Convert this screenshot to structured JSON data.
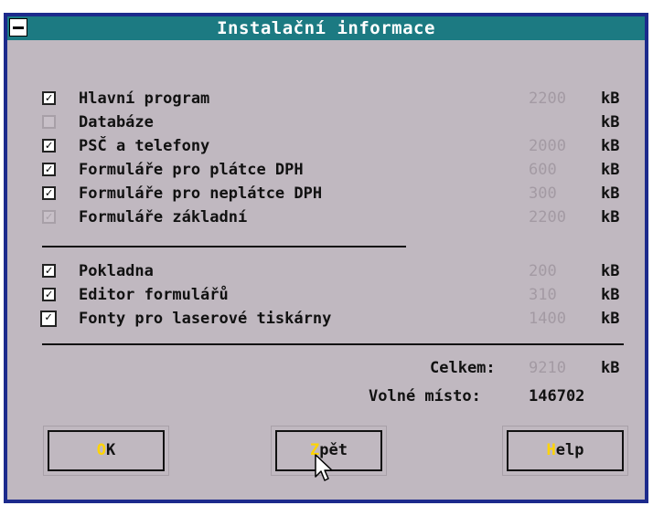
{
  "window": {
    "title": "Instalační informace"
  },
  "items_group1": [
    {
      "label": "Hlavní program",
      "size": "2200",
      "unit": "kB",
      "checked": true,
      "state": "normal"
    },
    {
      "label": "Databáze",
      "size": "",
      "unit": "kB",
      "checked": false,
      "state": "dim"
    },
    {
      "label": "PSČ a telefony",
      "size": "2000",
      "unit": "kB",
      "checked": true,
      "state": "normal"
    },
    {
      "label": "Formuláře pro plátce DPH",
      "size": "600",
      "unit": "kB",
      "checked": true,
      "state": "normal"
    },
    {
      "label": "Formuláře pro neplátce DPH",
      "size": "300",
      "unit": "kB",
      "checked": true,
      "state": "normal"
    },
    {
      "label": "Formuláře základní",
      "size": "2200",
      "unit": "kB",
      "checked": true,
      "state": "dim"
    }
  ],
  "items_group2": [
    {
      "label": "Pokladna",
      "size": "200",
      "unit": "kB",
      "checked": true,
      "state": "normal"
    },
    {
      "label": "Editor formulářů",
      "size": "310",
      "unit": "kB",
      "checked": true,
      "state": "normal"
    },
    {
      "label": "Fonty pro laserové tiskárny",
      "size": "1400",
      "unit": "kB",
      "checked": true,
      "state": "focused"
    }
  ],
  "summary": {
    "total_label": "Celkem:",
    "total_value": "9210",
    "total_unit": "kB",
    "free_label": "Volné místo:",
    "free_value": "146702"
  },
  "buttons": {
    "ok": {
      "hotkey": "O",
      "rest": "K"
    },
    "back": {
      "hotkey": "Z",
      "rest": "pět"
    },
    "help": {
      "hotkey": "H",
      "rest": "elp"
    }
  },
  "colors": {
    "title_bar": "#1c7a82",
    "frame": "#1c2a8c",
    "dialog_bg": "#c0b8c0",
    "hotkey": "#ffd400",
    "dim_text": "#a39aa3"
  },
  "icons": {
    "system_menu": "minus-box-icon",
    "checkbox": "checkmark-icon",
    "pointer": "arrow-cursor-icon"
  }
}
